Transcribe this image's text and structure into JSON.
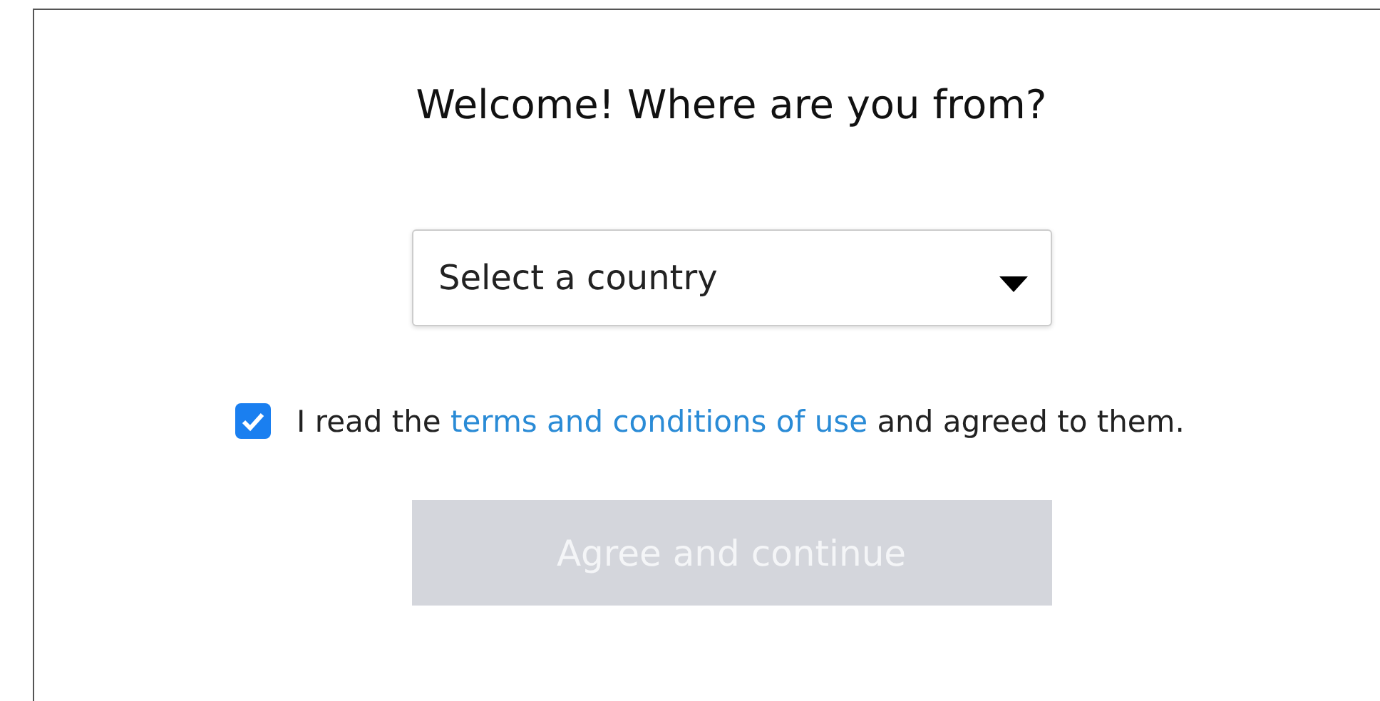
{
  "title": "Welcome! Where are you from?",
  "country_select": {
    "placeholder": "Select a country"
  },
  "agreement": {
    "checked": true,
    "text_before": "I read the ",
    "link": "terms and conditions of use",
    "text_after": " and agreed to them."
  },
  "continue_button": {
    "label": "Agree and continue",
    "disabled": true
  }
}
